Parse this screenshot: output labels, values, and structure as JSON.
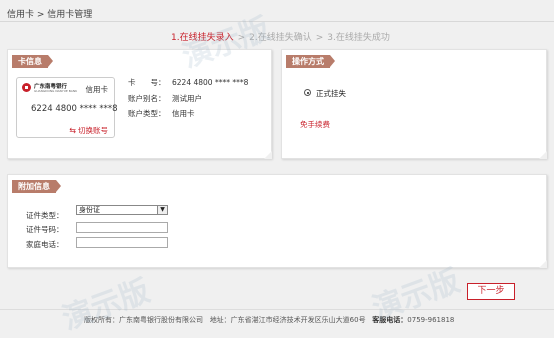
{
  "breadcrumb": "信用卡 > 信用卡管理",
  "steps": {
    "step1": "1.在线挂失录入",
    "step2": "2.在线挂失确认",
    "step3": "3.在线挂失成功",
    "sep": ">"
  },
  "card_info": {
    "tag": "卡信息",
    "bank_name": "广东南粤银行",
    "bank_name_en": "GUANGDONG NANYUE BANK",
    "card_type_badge": "信用卡",
    "card_number": "6224 4800 **** ***8",
    "switch_label": "切换账号",
    "rows": [
      {
        "label": "卡　　号：",
        "value": "6224 4800 **** ***8"
      },
      {
        "label": "账户别名：",
        "value": "测试用户"
      },
      {
        "label": "账户类型：",
        "value": "信用卡"
      }
    ]
  },
  "operation": {
    "tag": "操作方式",
    "radio_label": "正式挂失",
    "fee_text": "免手续费"
  },
  "extra": {
    "tag": "附加信息",
    "id_type_label": "证件类型：",
    "id_type_value": "身份证",
    "id_number_label": "证件号码：",
    "phone_label": "家庭电话："
  },
  "next_button": "下一步",
  "footer": {
    "copyright": "版权所有：广东南粤银行股份有限公司",
    "address": "地址：广东省湛江市经济技术开发区乐山大道60号",
    "hotline_label": "客服电话：",
    "hotline": "0759-961818"
  },
  "watermark": "演示版"
}
